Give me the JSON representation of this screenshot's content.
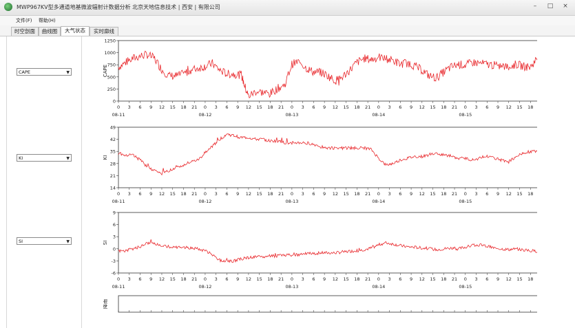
{
  "window": {
    "title": "MWP967KV型多通道地基微波辐射计数据分析   北京天地信息技术  |  西安  |  有限公司",
    "icon": "app-globe-icon",
    "controls": [
      "–",
      "□",
      "×"
    ]
  },
  "menu": [
    "文件(F)",
    "帮助(H)"
  ],
  "tabs": [
    "时空剖面",
    "曲线图",
    "大气状态",
    "实时廓线"
  ],
  "active_tab": 2,
  "selectors": [
    {
      "value": "CAPE"
    },
    {
      "value": "KI"
    },
    {
      "value": "SI"
    }
  ],
  "series_color": "#e8262a",
  "hour_labels": [
    "0",
    "3",
    "6",
    "9",
    "12",
    "15",
    "18",
    "21"
  ],
  "chart_data": [
    {
      "type": "line",
      "ylabel": "CAPE",
      "ylim": [
        0,
        1250
      ],
      "yticks": [
        "1250",
        "1000",
        "750",
        "500",
        "250",
        "0"
      ],
      "date_labels": [
        "08-11",
        "08-12",
        "08-13",
        "08-14",
        "08-15"
      ],
      "x_hours_range": [
        0,
        117
      ],
      "series": [
        {
          "values": [
            [
              0,
              700
            ],
            [
              2,
              800
            ],
            [
              4,
              880
            ],
            [
              6,
              930
            ],
            [
              8,
              960
            ],
            [
              10,
              880
            ],
            [
              12,
              650
            ],
            [
              14,
              520
            ],
            [
              16,
              520
            ],
            [
              18,
              560
            ],
            [
              20,
              640
            ],
            [
              22,
              680
            ],
            [
              24,
              720
            ],
            [
              26,
              780
            ],
            [
              28,
              640
            ],
            [
              30,
              560
            ],
            [
              32,
              560
            ],
            [
              34,
              540
            ],
            [
              35,
              300
            ],
            [
              36,
              100
            ],
            [
              38,
              200
            ],
            [
              40,
              180
            ],
            [
              42,
              150
            ],
            [
              44,
              260
            ],
            [
              46,
              330
            ],
            [
              48,
              760
            ],
            [
              50,
              820
            ],
            [
              52,
              680
            ],
            [
              54,
              600
            ],
            [
              56,
              600
            ],
            [
              58,
              520
            ],
            [
              60,
              420
            ],
            [
              62,
              500
            ],
            [
              64,
              640
            ],
            [
              66,
              800
            ],
            [
              68,
              880
            ],
            [
              70,
              860
            ],
            [
              72,
              900
            ],
            [
              74,
              880
            ],
            [
              76,
              840
            ],
            [
              78,
              760
            ],
            [
              80,
              800
            ],
            [
              82,
              720
            ],
            [
              84,
              640
            ],
            [
              86,
              520
            ],
            [
              88,
              480
            ],
            [
              90,
              600
            ],
            [
              92,
              700
            ],
            [
              94,
              760
            ],
            [
              96,
              740
            ],
            [
              98,
              800
            ],
            [
              100,
              780
            ],
            [
              102,
              760
            ],
            [
              104,
              740
            ],
            [
              106,
              720
            ],
            [
              108,
              700
            ],
            [
              110,
              760
            ],
            [
              112,
              720
            ],
            [
              114,
              700
            ],
            [
              116,
              900
            ]
          ]
        }
      ]
    },
    {
      "type": "line",
      "ylabel": "KI",
      "ylim": [
        14,
        49
      ],
      "yticks": [
        "49",
        "42",
        "35",
        "28",
        "21",
        "14"
      ],
      "date_labels": [
        "08-11",
        "08-12",
        "08-13",
        "08-14",
        "08-15"
      ],
      "x_hours_range": [
        0,
        117
      ],
      "series": [
        {
          "values": [
            [
              0,
              34
            ],
            [
              2,
              33
            ],
            [
              4,
              33
            ],
            [
              6,
              30
            ],
            [
              8,
              26
            ],
            [
              10,
              24
            ],
            [
              12,
              22
            ],
            [
              14,
              24
            ],
            [
              16,
              26
            ],
            [
              18,
              27
            ],
            [
              20,
              29
            ],
            [
              22,
              30
            ],
            [
              24,
              34
            ],
            [
              26,
              38
            ],
            [
              28,
              42
            ],
            [
              30,
              45
            ],
            [
              32,
              44
            ],
            [
              34,
              43
            ],
            [
              36,
              43
            ],
            [
              38,
              42
            ],
            [
              40,
              42
            ],
            [
              42,
              41
            ],
            [
              44,
              41
            ],
            [
              46,
              40
            ],
            [
              48,
              40
            ],
            [
              50,
              40
            ],
            [
              52,
              40
            ],
            [
              54,
              39
            ],
            [
              56,
              38
            ],
            [
              58,
              37
            ],
            [
              60,
              37
            ],
            [
              62,
              37
            ],
            [
              64,
              37
            ],
            [
              66,
              37
            ],
            [
              68,
              37
            ],
            [
              70,
              36
            ],
            [
              72,
              31
            ],
            [
              74,
              27
            ],
            [
              76,
              28
            ],
            [
              78,
              30
            ],
            [
              80,
              31
            ],
            [
              82,
              32
            ],
            [
              84,
              32
            ],
            [
              86,
              33
            ],
            [
              88,
              34
            ],
            [
              90,
              33
            ],
            [
              92,
              32
            ],
            [
              94,
              31
            ],
            [
              96,
              31
            ],
            [
              98,
              30
            ],
            [
              100,
              31
            ],
            [
              102,
              32
            ],
            [
              104,
              31
            ],
            [
              106,
              30
            ],
            [
              108,
              29
            ],
            [
              110,
              32
            ],
            [
              112,
              34
            ],
            [
              114,
              35
            ],
            [
              116,
              35
            ]
          ]
        }
      ]
    },
    {
      "type": "line",
      "ylabel": "SI",
      "ylim": [
        -6,
        9
      ],
      "yticks": [
        "9",
        "6",
        "3",
        "0",
        "-3",
        "-6"
      ],
      "date_labels": [
        "08-11",
        "08-12",
        "08-13",
        "08-14",
        "08-15"
      ],
      "x_hours_range": [
        0,
        117
      ],
      "series": [
        {
          "values": [
            [
              0,
              -0.5
            ],
            [
              2,
              -0.5
            ],
            [
              4,
              0
            ],
            [
              6,
              0.5
            ],
            [
              8,
              1.5
            ],
            [
              10,
              1.2
            ],
            [
              12,
              0.8
            ],
            [
              14,
              0.5
            ],
            [
              16,
              0.4
            ],
            [
              18,
              0.4
            ],
            [
              20,
              0.2
            ],
            [
              22,
              0
            ],
            [
              24,
              -0.5
            ],
            [
              26,
              -1.5
            ],
            [
              28,
              -2.8
            ],
            [
              30,
              -3.2
            ],
            [
              32,
              -3
            ],
            [
              34,
              -2.5
            ],
            [
              36,
              -2.2
            ],
            [
              38,
              -2
            ],
            [
              40,
              -2
            ],
            [
              42,
              -1.8
            ],
            [
              44,
              -1.8
            ],
            [
              46,
              -1.5
            ],
            [
              48,
              -1.5
            ],
            [
              50,
              -1.5
            ],
            [
              52,
              -1.2
            ],
            [
              54,
              -1.2
            ],
            [
              56,
              -1
            ],
            [
              58,
              -1
            ],
            [
              60,
              -1
            ],
            [
              62,
              -0.8
            ],
            [
              64,
              -0.6
            ],
            [
              66,
              -0.5
            ],
            [
              68,
              -0.2
            ],
            [
              70,
              0.2
            ],
            [
              72,
              1
            ],
            [
              74,
              1.5
            ],
            [
              76,
              1.2
            ],
            [
              78,
              0.8
            ],
            [
              80,
              0.5
            ],
            [
              82,
              0.4
            ],
            [
              84,
              0.2
            ],
            [
              86,
              0
            ],
            [
              88,
              -0.2
            ],
            [
              90,
              0
            ],
            [
              92,
              0.2
            ],
            [
              94,
              0
            ],
            [
              96,
              0.4
            ],
            [
              98,
              0.8
            ],
            [
              100,
              1
            ],
            [
              102,
              0.6
            ],
            [
              104,
              0.2
            ],
            [
              106,
              0
            ],
            [
              108,
              -0.2
            ],
            [
              110,
              0
            ],
            [
              112,
              -0.3
            ],
            [
              114,
              -0.5
            ],
            [
              116,
              -0.6
            ]
          ]
        }
      ]
    }
  ],
  "bottom_panel": {
    "ylabel": "降雨"
  }
}
